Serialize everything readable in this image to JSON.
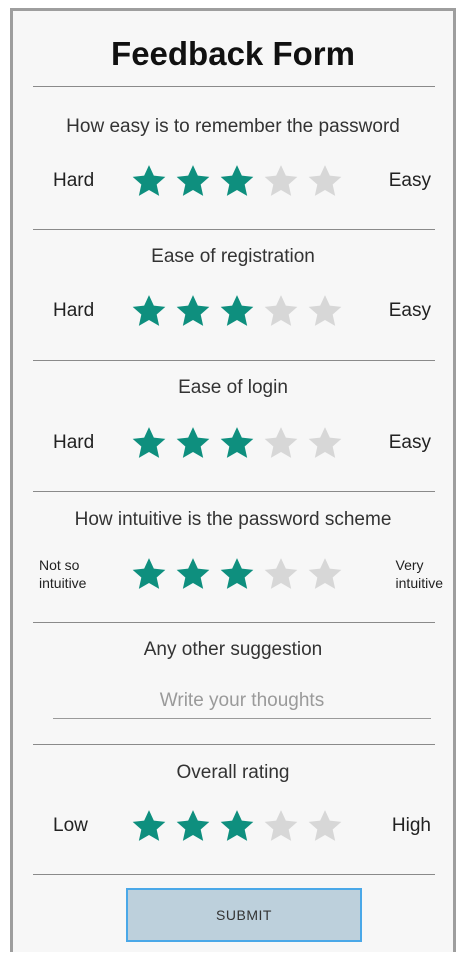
{
  "form": {
    "title": "Feedback Form",
    "accent_color": "#0e8f7e",
    "empty_star_color": "#d7d7d7"
  },
  "questions": [
    {
      "prompt": "How easy is to remember the password",
      "low_label": "Hard",
      "high_label": "Easy",
      "rating": 3,
      "max": 5
    },
    {
      "prompt": "Ease of registration",
      "low_label": "Hard",
      "high_label": "Easy",
      "rating": 3,
      "max": 5
    },
    {
      "prompt": "Ease of login",
      "low_label": "Hard",
      "high_label": "Easy",
      "rating": 3,
      "max": 5
    },
    {
      "prompt": "How intuitive is the password scheme",
      "low_label_line1": "Not so",
      "low_label_line2": "intuitive",
      "high_label_line1": "Very",
      "high_label_line2": "intuitive",
      "rating": 3,
      "max": 5
    }
  ],
  "suggestion": {
    "prompt": "Any other suggestion",
    "placeholder": "Write your thoughts",
    "value": ""
  },
  "overall": {
    "prompt": "Overall rating",
    "low_label": "Low",
    "high_label": "High",
    "rating": 3,
    "max": 5
  },
  "submit": {
    "label": "SUBMIT"
  }
}
